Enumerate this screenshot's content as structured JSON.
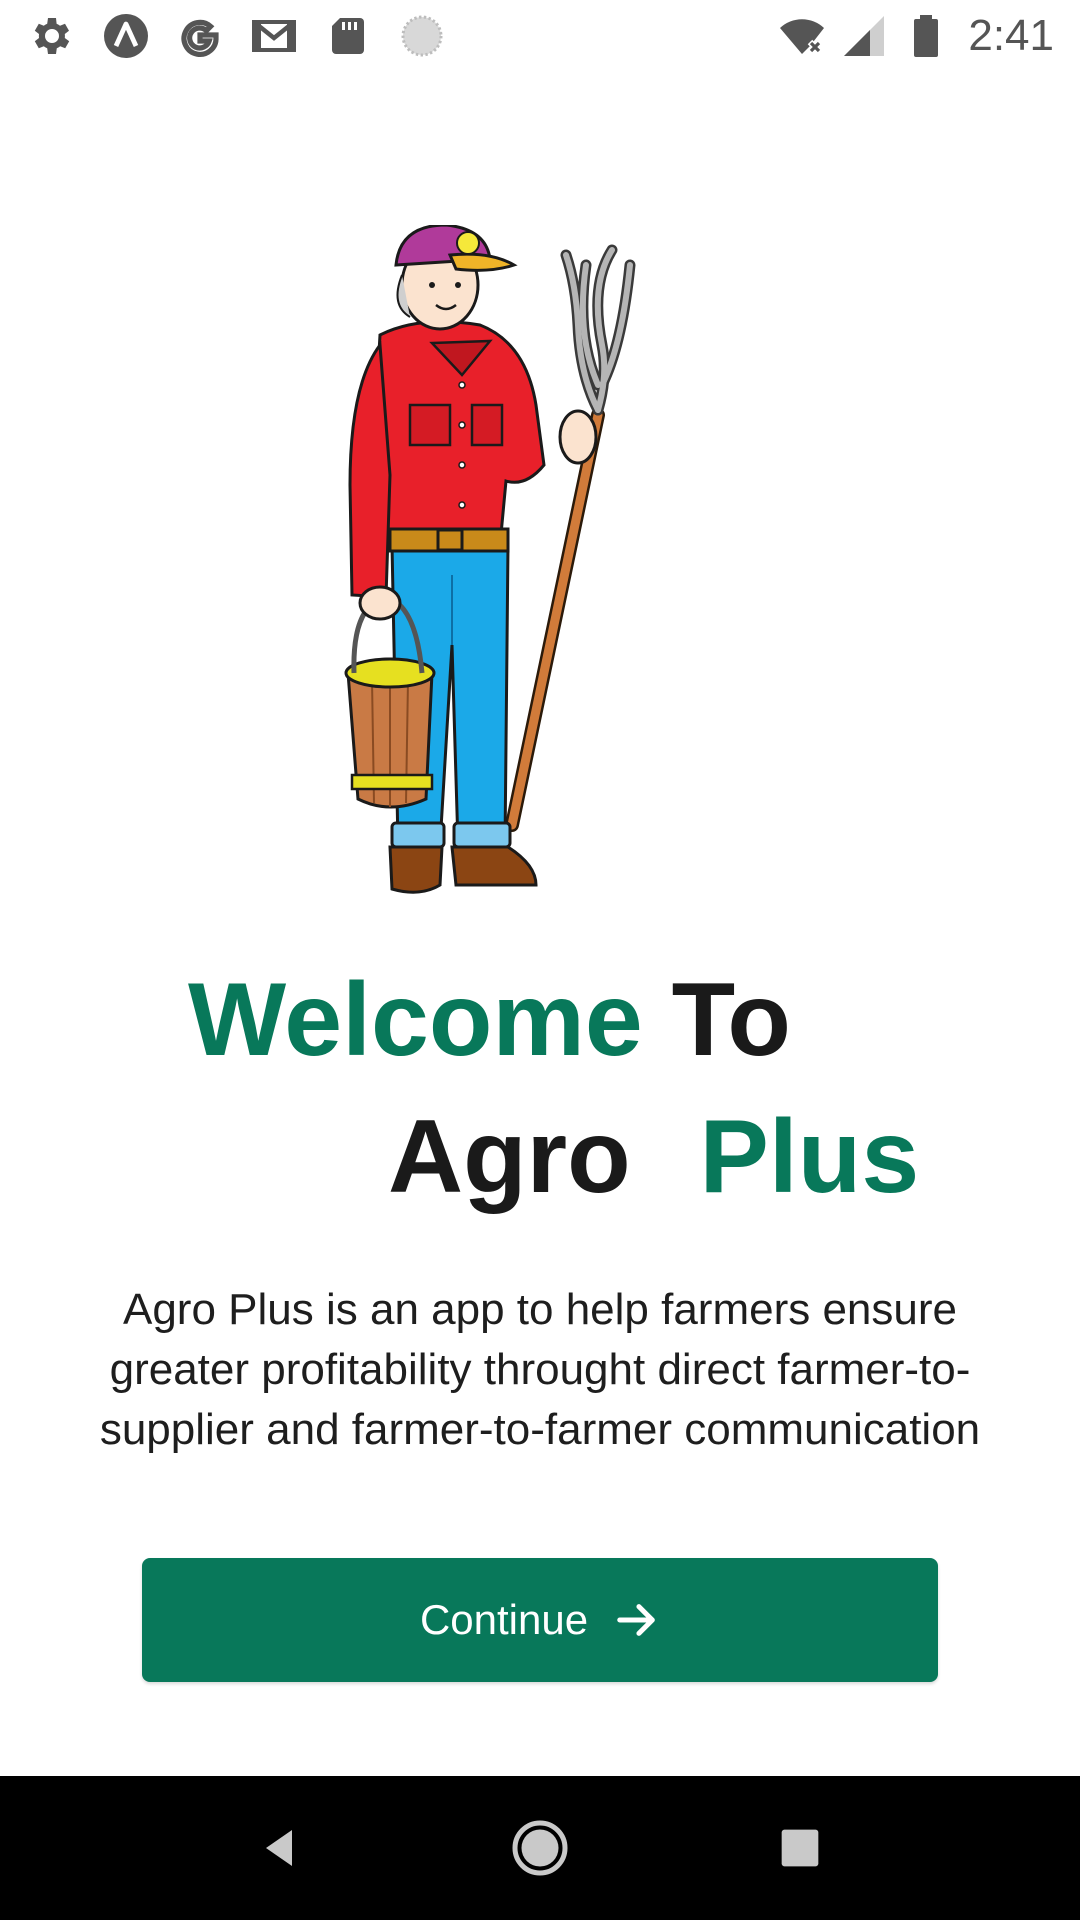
{
  "status_bar": {
    "time": "2:41",
    "left_icons": [
      "settings-icon",
      "app-a-icon",
      "google-icon",
      "gmail-icon",
      "sd-card-icon",
      "loading-icon"
    ],
    "right_icons": [
      "wifi-off-icon",
      "signal-icon",
      "battery-icon"
    ]
  },
  "illustration": {
    "name": "farmer-illustration"
  },
  "title": {
    "line1_green": "Welcome",
    "line1_dark": "To",
    "line2_dark": "Agro",
    "line2_green": "Plus"
  },
  "description": "Agro Plus is an app to help farmers ensure greater profitability throught direct farmer-to-supplier and farmer-to-farmer communication",
  "continue_button": {
    "label": "Continue"
  },
  "nav_bar": {
    "buttons": [
      "back-icon",
      "home-icon",
      "recents-icon"
    ]
  },
  "colors": {
    "accent": "#08785a",
    "text_dark": "#1a1a1a"
  }
}
